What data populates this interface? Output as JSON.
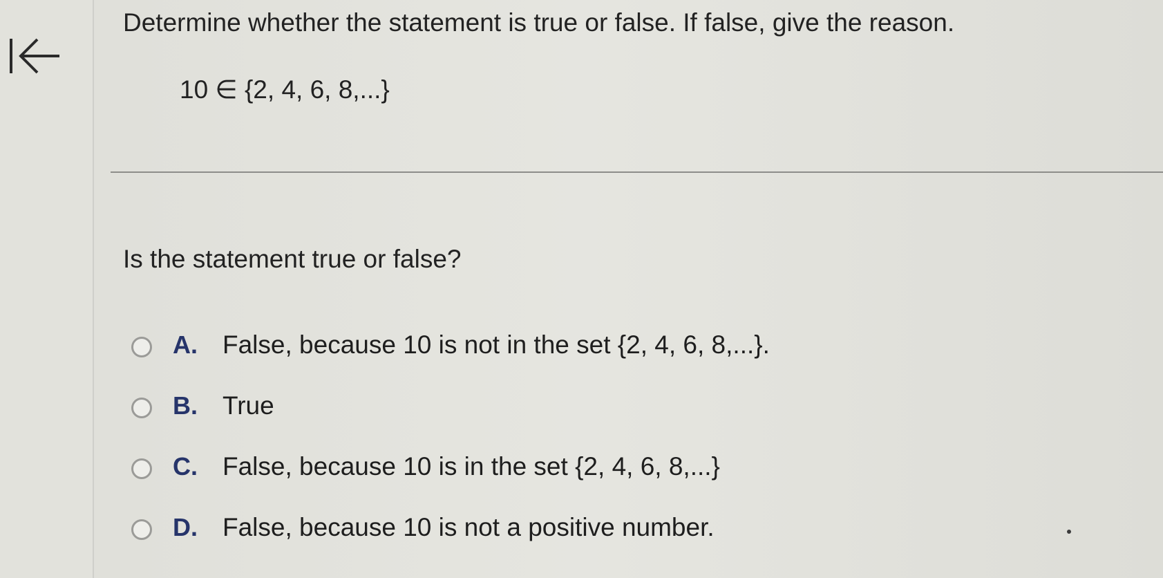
{
  "instruction": "Determine whether the statement is true or false. If false, give the reason.",
  "statement": "10 ∈ {2, 4, 6, 8,...}",
  "question": "Is the statement true or false?",
  "back_icon": "back-arrow-to-bar-icon",
  "options": [
    {
      "letter": "A.",
      "text": "False, because 10 is not in the set {2, 4, 6, 8,...}."
    },
    {
      "letter": "B.",
      "text": "True"
    },
    {
      "letter": "C.",
      "text": "False, because 10 is in the set {2, 4, 6, 8,...}"
    },
    {
      "letter": "D.",
      "text": "False, because 10 is not a positive number."
    }
  ],
  "colors": {
    "background": "#e4e4de",
    "option_letter": "#26346a",
    "radio_border": "#9b9b98",
    "divider": "#8d8d8a"
  }
}
